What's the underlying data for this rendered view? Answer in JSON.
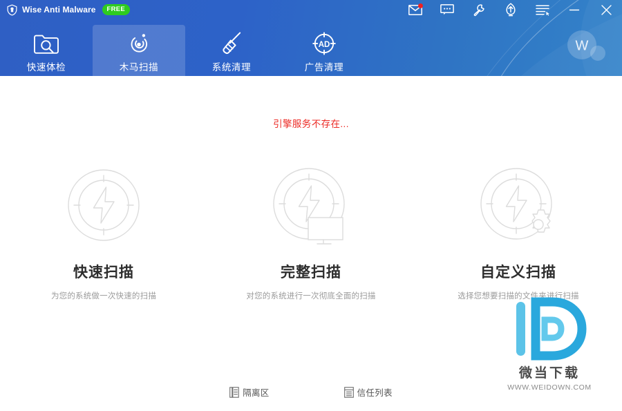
{
  "window": {
    "title": "Wise Anti Malware",
    "badge": "FREE",
    "logo_icon": "shield-icon",
    "titlebar_buttons": [
      {
        "name": "messages-icon",
        "glyph": "envelope",
        "has_notification": true
      },
      {
        "name": "feedback-icon",
        "glyph": "chat-bubble",
        "has_notification": false
      },
      {
        "name": "tools-icon",
        "glyph": "wrench",
        "has_notification": false
      },
      {
        "name": "upgrade-icon",
        "glyph": "up-arrow",
        "has_notification": false
      },
      {
        "name": "menu-icon",
        "glyph": "list-menu",
        "has_notification": false
      },
      {
        "name": "minimize-button",
        "glyph": "minimize",
        "has_notification": false
      },
      {
        "name": "close-button",
        "glyph": "close",
        "has_notification": false
      }
    ]
  },
  "nav": {
    "tabs": [
      {
        "label": "快速体检",
        "icon": "folder-search-icon",
        "active": false
      },
      {
        "label": "木马扫描",
        "icon": "radar-scan-icon",
        "active": true
      },
      {
        "label": "系统清理",
        "icon": "broom-icon",
        "active": false
      },
      {
        "label": "广告清理",
        "icon": "ad-target-icon",
        "active": false
      }
    ]
  },
  "account": {
    "avatar_initial": "W",
    "avatar_icon": "user-avatar"
  },
  "main": {
    "status_message": "引擎服务不存在...",
    "status_color": "#ec2a24",
    "scan_options": [
      {
        "title": "快速扫描",
        "description": "为您的系统做一次快速的扫描",
        "icon": "quick-scan-icon"
      },
      {
        "title": "完整扫描",
        "description": "对您的系统进行一次彻底全面的扫描",
        "icon": "full-scan-icon"
      },
      {
        "title": "自定义扫描",
        "description": "选择您想要扫描的文件夹进行扫描",
        "icon": "custom-scan-icon"
      }
    ],
    "footer_links": [
      {
        "label": "隔离区",
        "icon": "quarantine-icon"
      },
      {
        "label": "信任列表",
        "icon": "trust-list-icon"
      }
    ]
  },
  "watermark": {
    "logo_letter": "D",
    "site_name": "微当下载",
    "site_url": "WWW.WEIDOWN.COM",
    "color": "#35a8e0"
  },
  "colors": {
    "header_start": "#2f5fc4",
    "header_end": "#3383c9",
    "accent_green": "#2ecb1f",
    "error_red": "#ec2a24",
    "title_text": "#2d2d2d",
    "desc_text": "#9b9b9b"
  }
}
